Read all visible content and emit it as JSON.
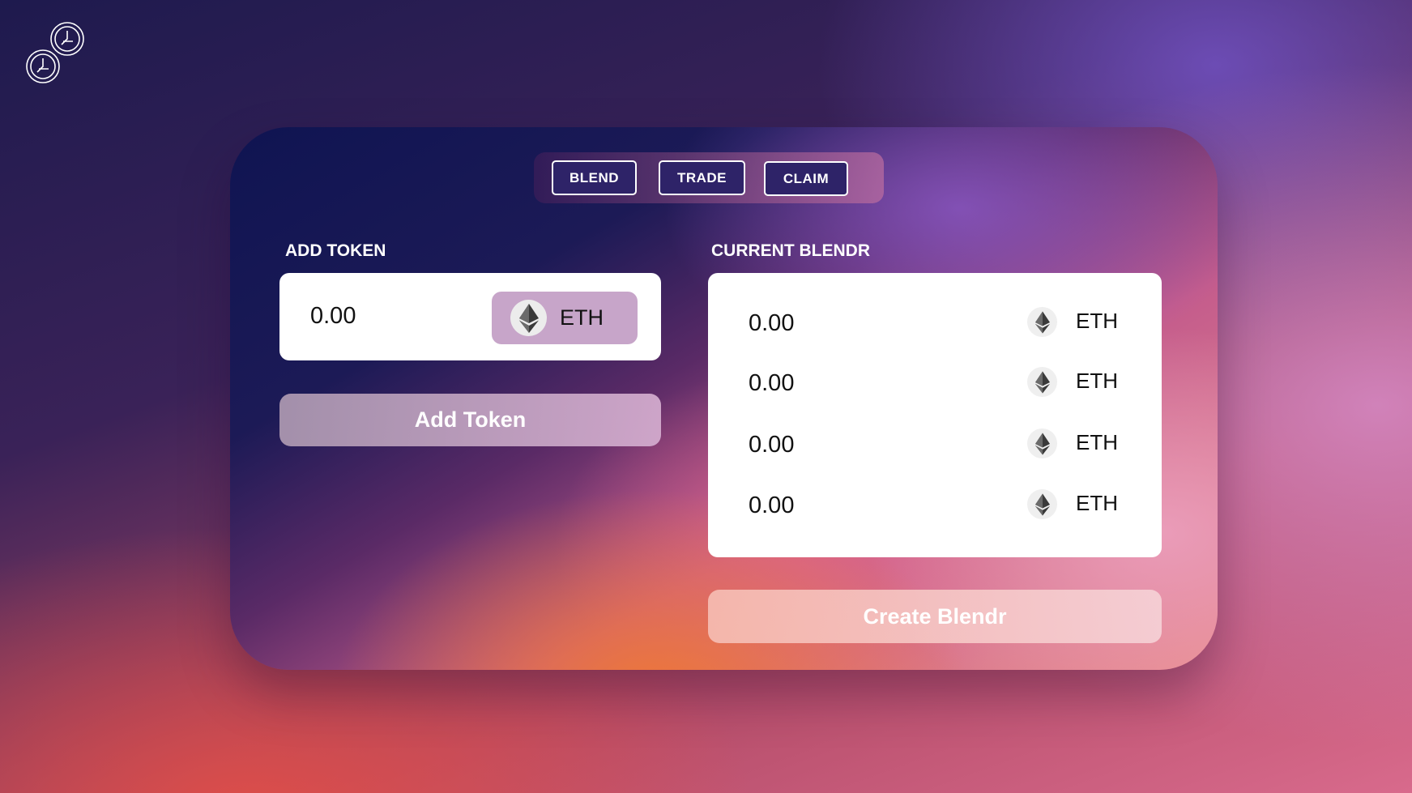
{
  "logo": {
    "icon": "coins-logo-icon"
  },
  "tabs": [
    {
      "label": "BLEND"
    },
    {
      "label": "TRADE"
    },
    {
      "label": "CLAIM"
    }
  ],
  "add_token": {
    "section_label": "ADD TOKEN",
    "amount": "0.00",
    "token": "ETH",
    "token_icon": "ethereum-icon",
    "button_label": "Add Token"
  },
  "current_blendr": {
    "section_label": "CURRENT BLENDR",
    "rows": [
      {
        "amount": "0.00",
        "token": "ETH"
      },
      {
        "amount": "0.00",
        "token": "ETH"
      },
      {
        "amount": "0.00",
        "token": "ETH"
      },
      {
        "amount": "0.00",
        "token": "ETH"
      }
    ],
    "button_label": "Create Blendr"
  },
  "colors": {
    "tab_bg": "#2e2368",
    "token_select_bg": "#c7a5c9",
    "panel_bg": "#ffffff"
  }
}
